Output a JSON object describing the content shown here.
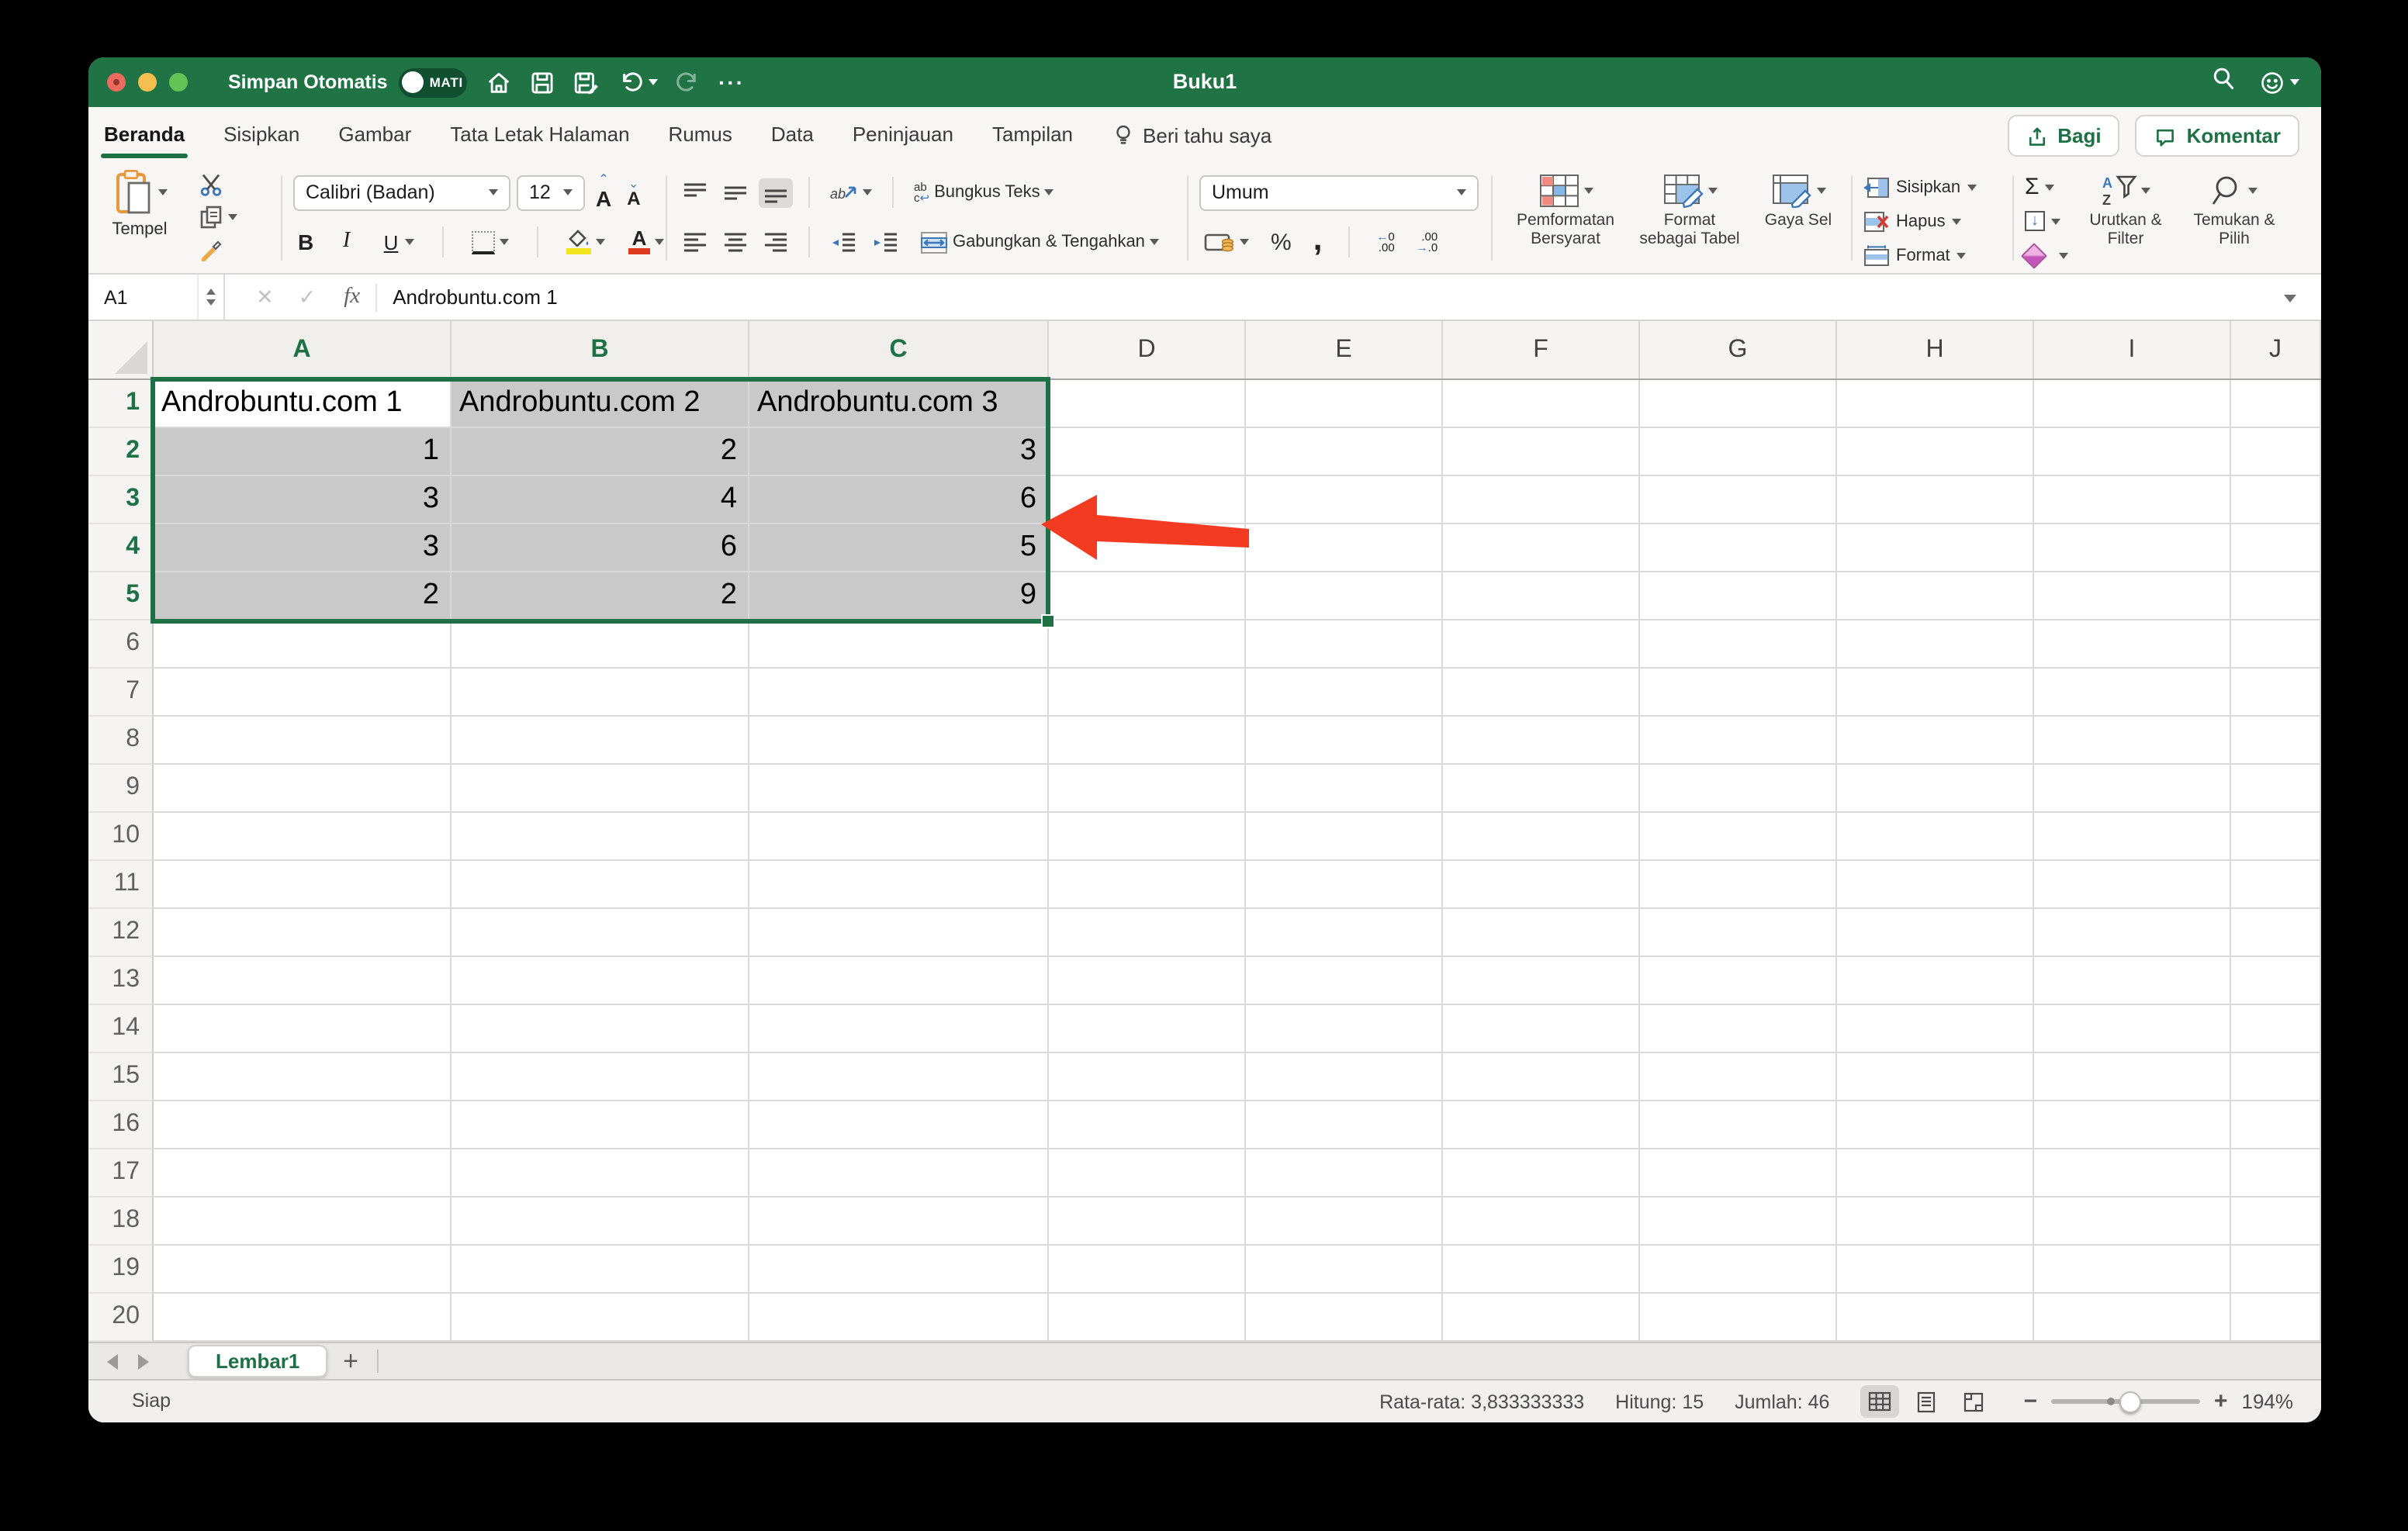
{
  "titlebar": {
    "autosave_label": "Simpan Otomatis",
    "autosave_state": "MATI",
    "title": "Buku1"
  },
  "ribbon_tabs": {
    "items": [
      "Beranda",
      "Sisipkan",
      "Gambar",
      "Tata Letak Halaman",
      "Rumus",
      "Data",
      "Peninjauan",
      "Tampilan"
    ],
    "active": "Beranda",
    "tell_me": "Beri tahu saya",
    "share": "Bagi",
    "comment": "Komentar"
  },
  "ribbon": {
    "paste_label": "Tempel",
    "font_name": "Calibri (Badan)",
    "font_size": "12",
    "wrap_label": "Bungkus Teks",
    "merge_label": "Gabungkan & Tengahkan",
    "number_format": "Umum",
    "styles": {
      "conditional": [
        "Pemformatan",
        "Bersyarat"
      ],
      "table": [
        "Format",
        "sebagai Tabel"
      ],
      "cell_styles": "Gaya Sel"
    },
    "cells": {
      "insert": "Sisipkan",
      "delete": "Hapus",
      "format": "Format"
    },
    "editing": {
      "sort": [
        "Urutkan &",
        "Filter"
      ],
      "find": [
        "Temukan &",
        "Pilih"
      ]
    }
  },
  "formula_bar": {
    "name_box": "A1",
    "fx_label": "fx",
    "value": "Androbuntu.com 1"
  },
  "grid": {
    "columns": [
      {
        "label": "A",
        "width": 192,
        "in_selection": true
      },
      {
        "label": "B",
        "width": 192,
        "in_selection": true
      },
      {
        "label": "C",
        "width": 193,
        "in_selection": true
      },
      {
        "label": "D",
        "width": 127
      },
      {
        "label": "E",
        "width": 127
      },
      {
        "label": "F",
        "width": 127
      },
      {
        "label": "G",
        "width": 127
      },
      {
        "label": "H",
        "width": 127
      },
      {
        "label": "I",
        "width": 127
      },
      {
        "label": "J",
        "width": 58
      }
    ],
    "row_count": 20,
    "cells": [
      [
        "Androbuntu.com 1",
        "Androbuntu.com 2",
        "Androbuntu.com 3"
      ],
      [
        1,
        2,
        3
      ],
      [
        3,
        4,
        6
      ],
      [
        3,
        6,
        5
      ],
      [
        2,
        2,
        9
      ]
    ],
    "selection": {
      "range": "A1:C5",
      "active_cell": "A1",
      "rows": [
        1,
        5
      ],
      "cols": [
        0,
        2
      ]
    }
  },
  "sheet_bar": {
    "tab": "Lembar1",
    "add_label": "+"
  },
  "status_bar": {
    "ready": "Siap",
    "average": "Rata-rata: 3,833333333",
    "count": "Hitung: 15",
    "sum": "Jumlah: 46",
    "zoom": "194%"
  },
  "colors": {
    "accent": "#1E7145",
    "selection_fill": "#C9C9C9",
    "arrow": "#F23B20"
  }
}
